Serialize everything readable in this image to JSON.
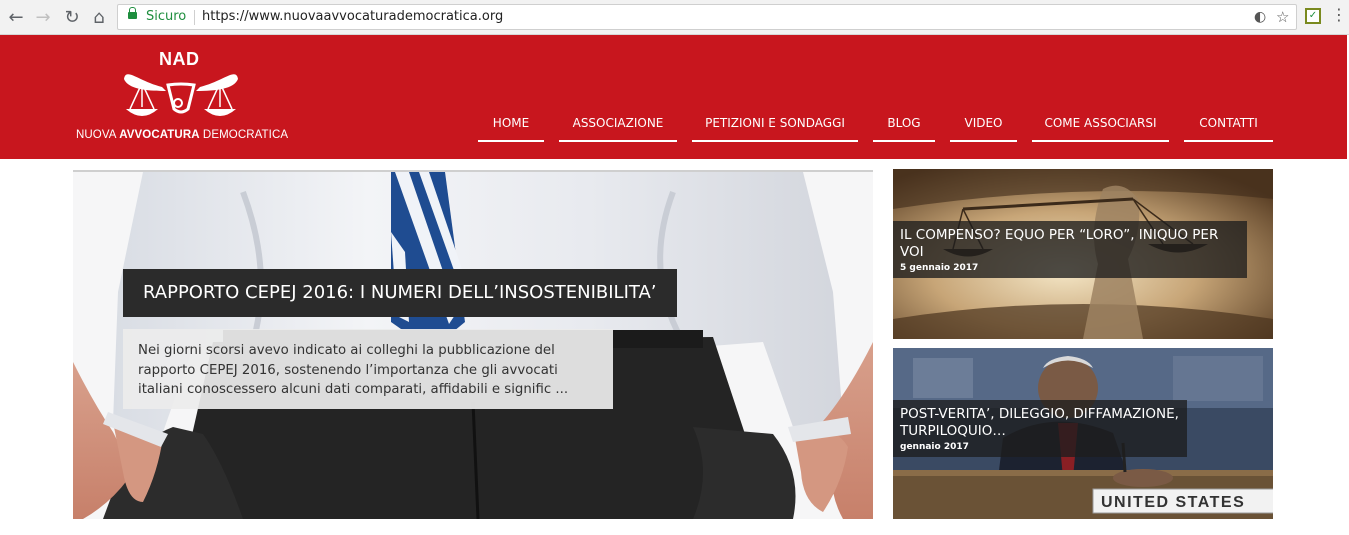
{
  "browser": {
    "secure_label": "Sicuro",
    "url": "https://www.nuovaavvocaturademocratica.org",
    "extension_badge": "✓"
  },
  "site": {
    "logo_abbr": "NAD",
    "logo_name_prefix": "NUOVA ",
    "logo_name_bold": "AVVOCATURA",
    "logo_name_suffix": " DEMOCRATICA",
    "brand_color": "#c8161e"
  },
  "nav": {
    "items": [
      {
        "label": "HOME"
      },
      {
        "label": "ASSOCIAZIONE"
      },
      {
        "label": "PETIZIONI E SONDAGGI"
      },
      {
        "label": "BLOG"
      },
      {
        "label": "VIDEO"
      },
      {
        "label": "COME ASSOCIARSI"
      },
      {
        "label": "CONTATTI"
      }
    ]
  },
  "hero": {
    "title": "RAPPORTO CEPEJ 2016: I NUMERI DELL’INSOSTENIBILITA’",
    "excerpt": "Nei giorni scorsi avevo indicato ai colleghi la pubblicazione del rapporto CEPEJ 2016, sostenendo l’importanza che gli avvocati italiani conoscessero alcuni dati comparati, affidabili e signific ..."
  },
  "side_posts": [
    {
      "title": "IL COMPENSO? EQUO PER “LORO”, INIQUO PER VOI",
      "date": "5 gennaio 2017"
    },
    {
      "title": "POST-VERITA’, DILEGGIO, DIFFAMAZIONE, TURPILOQUIO…",
      "date": "gennaio 2017",
      "placard": "UNITED STATES"
    }
  ]
}
